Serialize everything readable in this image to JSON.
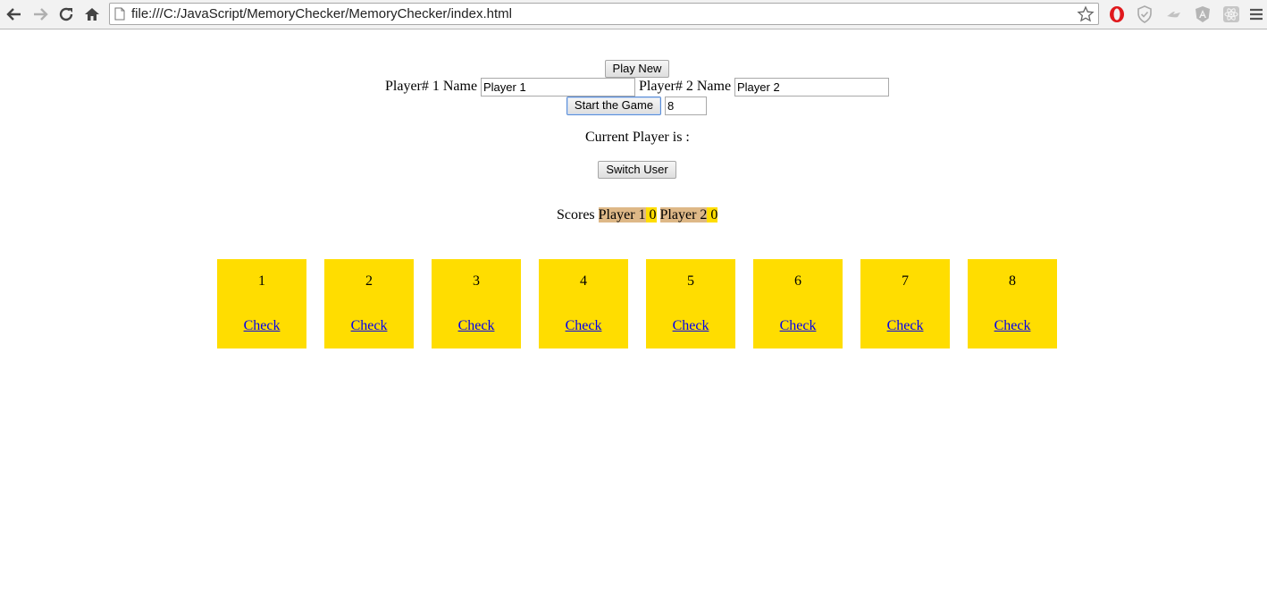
{
  "browser": {
    "url": "file:///C:/JavaScript/MemoryChecker/MemoryChecker/index.html",
    "icons": [
      "back-arrow-icon",
      "forward-arrow-icon",
      "reload-icon",
      "home-icon",
      "page-icon",
      "bookmark-star-icon",
      "opera-icon",
      "shield-icon",
      "extension-icon",
      "angular-icon",
      "react-icon",
      "menu-icon"
    ]
  },
  "controls": {
    "play_new_label": "Play New",
    "player1_label": "Player# 1 Name",
    "player1_value": "Player 1",
    "player2_label": "Player# 2 Name",
    "player2_value": "Player 2",
    "start_label": "Start the Game",
    "count_value": "8",
    "current_player_label": "Current Player is :",
    "switch_user_label": "Switch User"
  },
  "scores": {
    "label": "Scores",
    "player1_name": "Player 1",
    "player1_score": "0",
    "player2_name": "Player 2",
    "player2_score": "0"
  },
  "cards": [
    {
      "number": "1",
      "link": "Check"
    },
    {
      "number": "2",
      "link": "Check"
    },
    {
      "number": "3",
      "link": "Check"
    },
    {
      "number": "4",
      "link": "Check"
    },
    {
      "number": "5",
      "link": "Check"
    },
    {
      "number": "6",
      "link": "Check"
    },
    {
      "number": "7",
      "link": "Check"
    },
    {
      "number": "8",
      "link": "Check"
    }
  ],
  "colors": {
    "card_bg": "#ffdd00",
    "score_name_bg": "#deb887",
    "link": "#0000ee"
  }
}
